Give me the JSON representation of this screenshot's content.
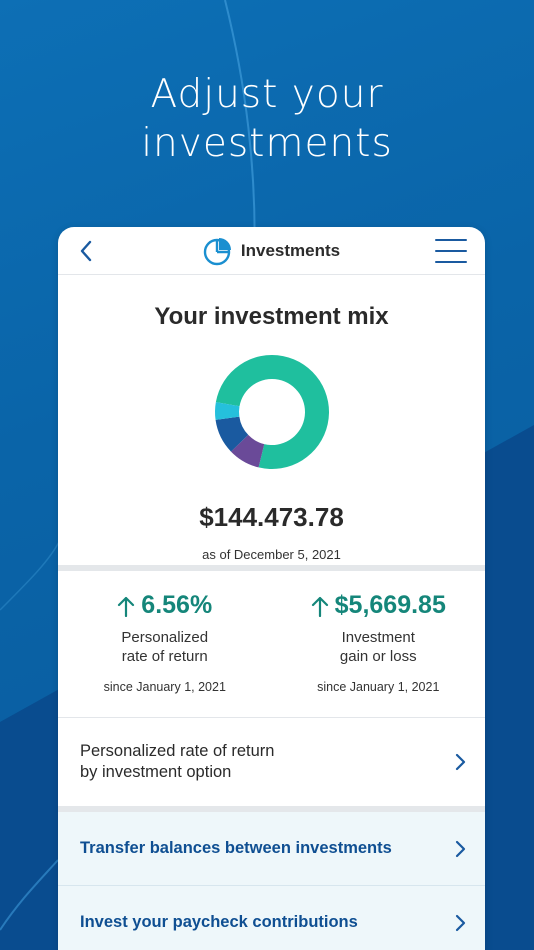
{
  "headline": {
    "line1": "Adjust your",
    "line2": "investments"
  },
  "appbar": {
    "title": "Investments",
    "back_icon": "chevron-left-icon",
    "menu_icon": "hamburger-menu-icon",
    "logo_icon": "pie-chart-icon"
  },
  "mix": {
    "heading": "Your investment mix",
    "balance": "$144.473.78",
    "as_of": "as of December 5, 2021",
    "allocation": [
      {
        "color": "#1fbf9e",
        "fraction": 0.76
      },
      {
        "color": "#6a4a98",
        "fraction": 0.09
      },
      {
        "color": "#1a5aa0",
        "fraction": 0.1
      },
      {
        "color": "#25c0dc",
        "fraction": 0.05
      }
    ]
  },
  "stats": {
    "rate": {
      "value": "6.56%",
      "label_line1": "Personalized",
      "label_line2": "rate of return",
      "since": "since January 1, 2021"
    },
    "gain": {
      "value": "$5,669.85",
      "label_line1": "Investment",
      "label_line2": "gain or loss",
      "since": "since January 1, 2021"
    },
    "accent_color": "#15867a"
  },
  "options": {
    "rate_by_option_line1": "Personalized rate of return",
    "rate_by_option_line2": "by investment option",
    "transfer": "Transfer balances between investments",
    "paycheck": "Invest your paycheck contributions"
  }
}
